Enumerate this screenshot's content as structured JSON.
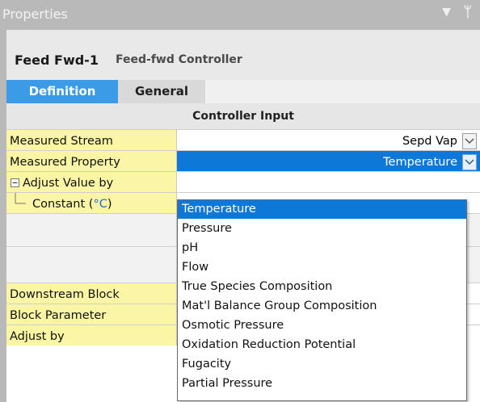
{
  "window": {
    "title": "Properties"
  },
  "header": {
    "block_name": "Feed Fwd-1",
    "block_type": "Feed-fwd Controller"
  },
  "tabs": [
    {
      "label": "Definition",
      "active": true
    },
    {
      "label": "General",
      "active": false
    }
  ],
  "section": {
    "title": "Controller Input"
  },
  "rows": {
    "measured_stream": {
      "label": "Measured Stream",
      "value": "Sepd Vap"
    },
    "measured_property": {
      "label": "Measured Property",
      "value": "Temperature"
    },
    "adjust_value_by": {
      "label": "Adjust Value by"
    },
    "constant": {
      "label": "Constant (",
      "unit": "°C",
      "close": ")"
    },
    "downstream_block": {
      "label": "Downstream Block"
    },
    "block_parameter": {
      "label": "Block Parameter"
    },
    "adjust_by": {
      "label": "Adjust by"
    }
  },
  "dropdown": {
    "options": [
      "Temperature",
      "Pressure",
      "pH",
      "Flow",
      "True Species Composition",
      "Mat'l Balance Group Composition",
      "Osmotic Pressure",
      "Oxidation Reduction Potential",
      "Fugacity",
      "Partial Pressure"
    ],
    "highlighted": "Temperature"
  },
  "colors": {
    "accent": "#0e78d8",
    "tab_active": "#3c9be6",
    "label_bg": "#fbf6a6",
    "unit_text": "#1e6fd0"
  },
  "icons": {
    "collapse": "minus-box-icon",
    "tree": "tree-branch-icon",
    "dropdown": "chevron-down-icon",
    "pin": "pin-icon"
  }
}
